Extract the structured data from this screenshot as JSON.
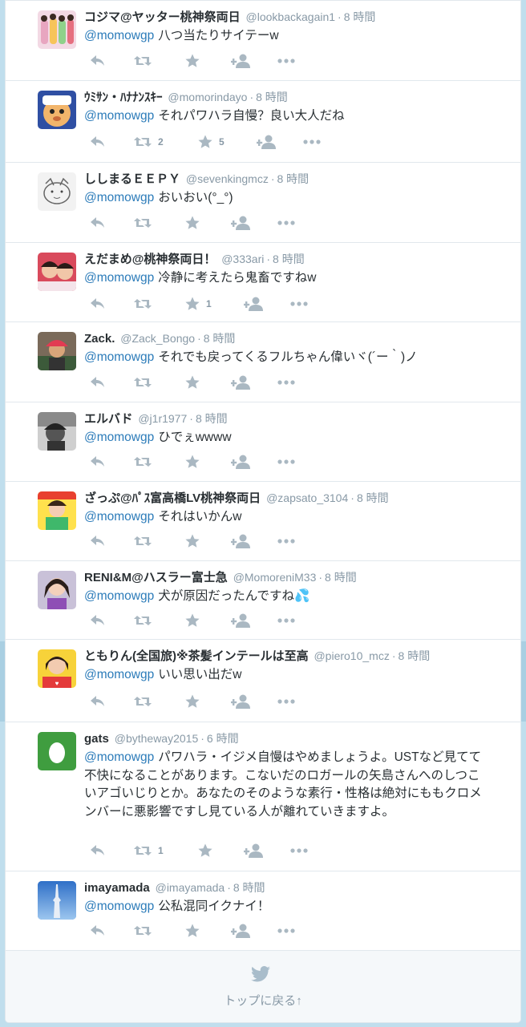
{
  "colors": {
    "page_bg": "#c0deed",
    "link": "#2b7bb9",
    "muted": "#8899a6",
    "action_icon": "#aab8c2",
    "text": "#292f33"
  },
  "tweets": [
    {
      "name": "コジマ@ヤッター桃神祭両日",
      "screen": "@lookbackagain1",
      "time": "8 時間",
      "mention": "@momowgp",
      "text": "八つ当たりサイテーw",
      "retweets": "",
      "favorites": "",
      "avatar": "group-photo"
    },
    {
      "name": "ｳﾐｻﾝ・ﾊﾅﾅﾝｽｷｰ",
      "screen": "@momorindayo",
      "time": "8 時間",
      "mention": "@momowgp",
      "text": "それパワハラ自慢？良い大人だね",
      "retweets": "2",
      "favorites": "5",
      "avatar": "cartoon-face"
    },
    {
      "name": "ししまるＥＥＰＹ",
      "screen": "@sevenkingmcz",
      "time": "8 時間",
      "mention": "@momowgp",
      "text": "おいおい(°_°)",
      "retweets": "",
      "favorites": "",
      "avatar": "cat-sketch"
    },
    {
      "name": "えだまめ@桃神祭両日！",
      "screen": "@333ari",
      "time": "8 時間",
      "mention": "@momowgp",
      "text": "冷静に考えたら鬼畜ですねw",
      "retweets": "",
      "favorites": "1",
      "avatar": "two-girls"
    },
    {
      "name": "Zack.",
      "screen": "@Zack_Bongo",
      "time": "8 時間",
      "mention": "@momowgp",
      "text": "それでも戻ってくるフルちゃん偉いヾ(´ー｀)ノ",
      "retweets": "",
      "favorites": "",
      "avatar": "cap-person"
    },
    {
      "name": "エルバド",
      "screen": "@j1r1977",
      "time": "8 時間",
      "mention": "@momowgp",
      "text": "ひでぇwwww",
      "retweets": "",
      "favorites": "",
      "avatar": "bw-profile"
    },
    {
      "name": "ざっぷ@ﾊﾟｽ富高橋LV桃神祭両日",
      "screen": "@zapsato_3104",
      "time": "8 時間",
      "mention": "@momowgp",
      "text": "それはいかんw",
      "retweets": "",
      "favorites": "",
      "avatar": "green-girl"
    },
    {
      "name": "RENI&M@ハスラー富士急",
      "screen": "@MomoreniM33",
      "time": "8 時間",
      "mention": "@momowgp",
      "text": "犬が原因だったんですね💦",
      "retweets": "",
      "favorites": "",
      "avatar": "purple-girl"
    },
    {
      "name": "ともりん(全国旅)※茶髪インテールは至高",
      "screen": "@piero10_mcz",
      "time": "8 時間",
      "mention": "@momowgp",
      "text": "いい思い出だw",
      "retweets": "",
      "favorites": "",
      "avatar": "yellow-girl"
    },
    {
      "name": "gats",
      "screen": "@bytheway2015",
      "time": "6 時間",
      "mention": "@momowgp",
      "text": "パワハラ・イジメ自慢はやめましょうよ。USTなど見てて不快になることがあります。こないだのロガールの矢島さんへのしつこいアゴいじりとか。あなたのそのような素行・性格は絶対にももクロメンバーに悪影響ですし見ている人が離れていきますよ。",
      "retweets": "1",
      "favorites": "",
      "avatar": "default-egg"
    },
    {
      "name": "imayamada",
      "screen": "@imayamada",
      "time": "8 時間",
      "mention": "@momowgp",
      "text": "公私混同イクナイ！",
      "retweets": "",
      "favorites": "",
      "avatar": "sky-tower"
    }
  ],
  "footer": {
    "back_to_top": "トップに戻る↑"
  }
}
